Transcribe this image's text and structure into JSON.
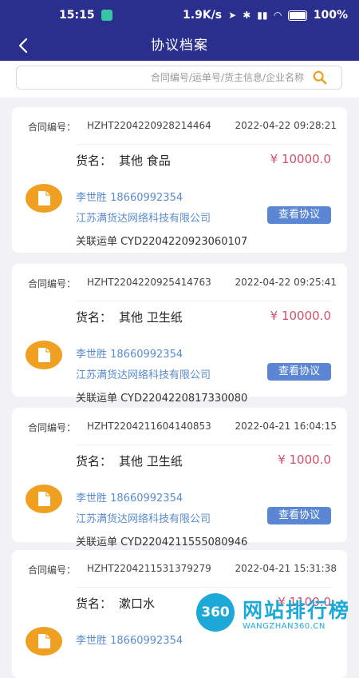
{
  "status_bar": {
    "time": "15:15",
    "network_speed": "1.9K/s",
    "battery": "100%"
  },
  "nav": {
    "title": "协议档案"
  },
  "search": {
    "placeholder": "合同编号/运单号/货主信息/企业名称"
  },
  "labels": {
    "contract_no": "合同编号：",
    "goods": "货名：",
    "waybill": "关联运单",
    "view": "查看协议"
  },
  "cards": [
    {
      "contract_no": "HZHT2204220928214464",
      "time": "2022-04-22 09:28:21",
      "goods": "其他 食品",
      "price": "¥ 10000.0",
      "contact": "李世胜 18660992354",
      "company": "江苏满货达网络科技有限公司",
      "waybill": "CYD2204220923060107"
    },
    {
      "contract_no": "HZHT2204220925414763",
      "time": "2022-04-22 09:25:41",
      "goods": "其他 卫生纸",
      "price": "¥ 10000.0",
      "contact": "李世胜 18660992354",
      "company": "江苏满货达网络科技有限公司",
      "waybill": "CYD2204220817330080"
    },
    {
      "contract_no": "HZHT2204211604140853",
      "time": "2022-04-21 16:04:15",
      "goods": "其他 卫生纸",
      "price": "¥ 1000.0",
      "contact": "李世胜 18660992354",
      "company": "江苏满货达网络科技有限公司",
      "waybill": "CYD2204211555080946"
    },
    {
      "contract_no": "HZHT2204211531379279",
      "time": "2022-04-21 15:31:38",
      "goods": "漱口水",
      "price": "¥ 1100.0",
      "contact": "李世胜 18660992354",
      "company": "",
      "waybill": ""
    }
  ],
  "watermark": {
    "badge": "360",
    "name": "网站排行榜",
    "url": "WANGZHAN360.CN"
  },
  "colors": {
    "header": "#2a2f8e",
    "price": "#d0516d",
    "link": "#5a8bd0",
    "button": "#5b86d4",
    "icon": "#f0a020"
  }
}
